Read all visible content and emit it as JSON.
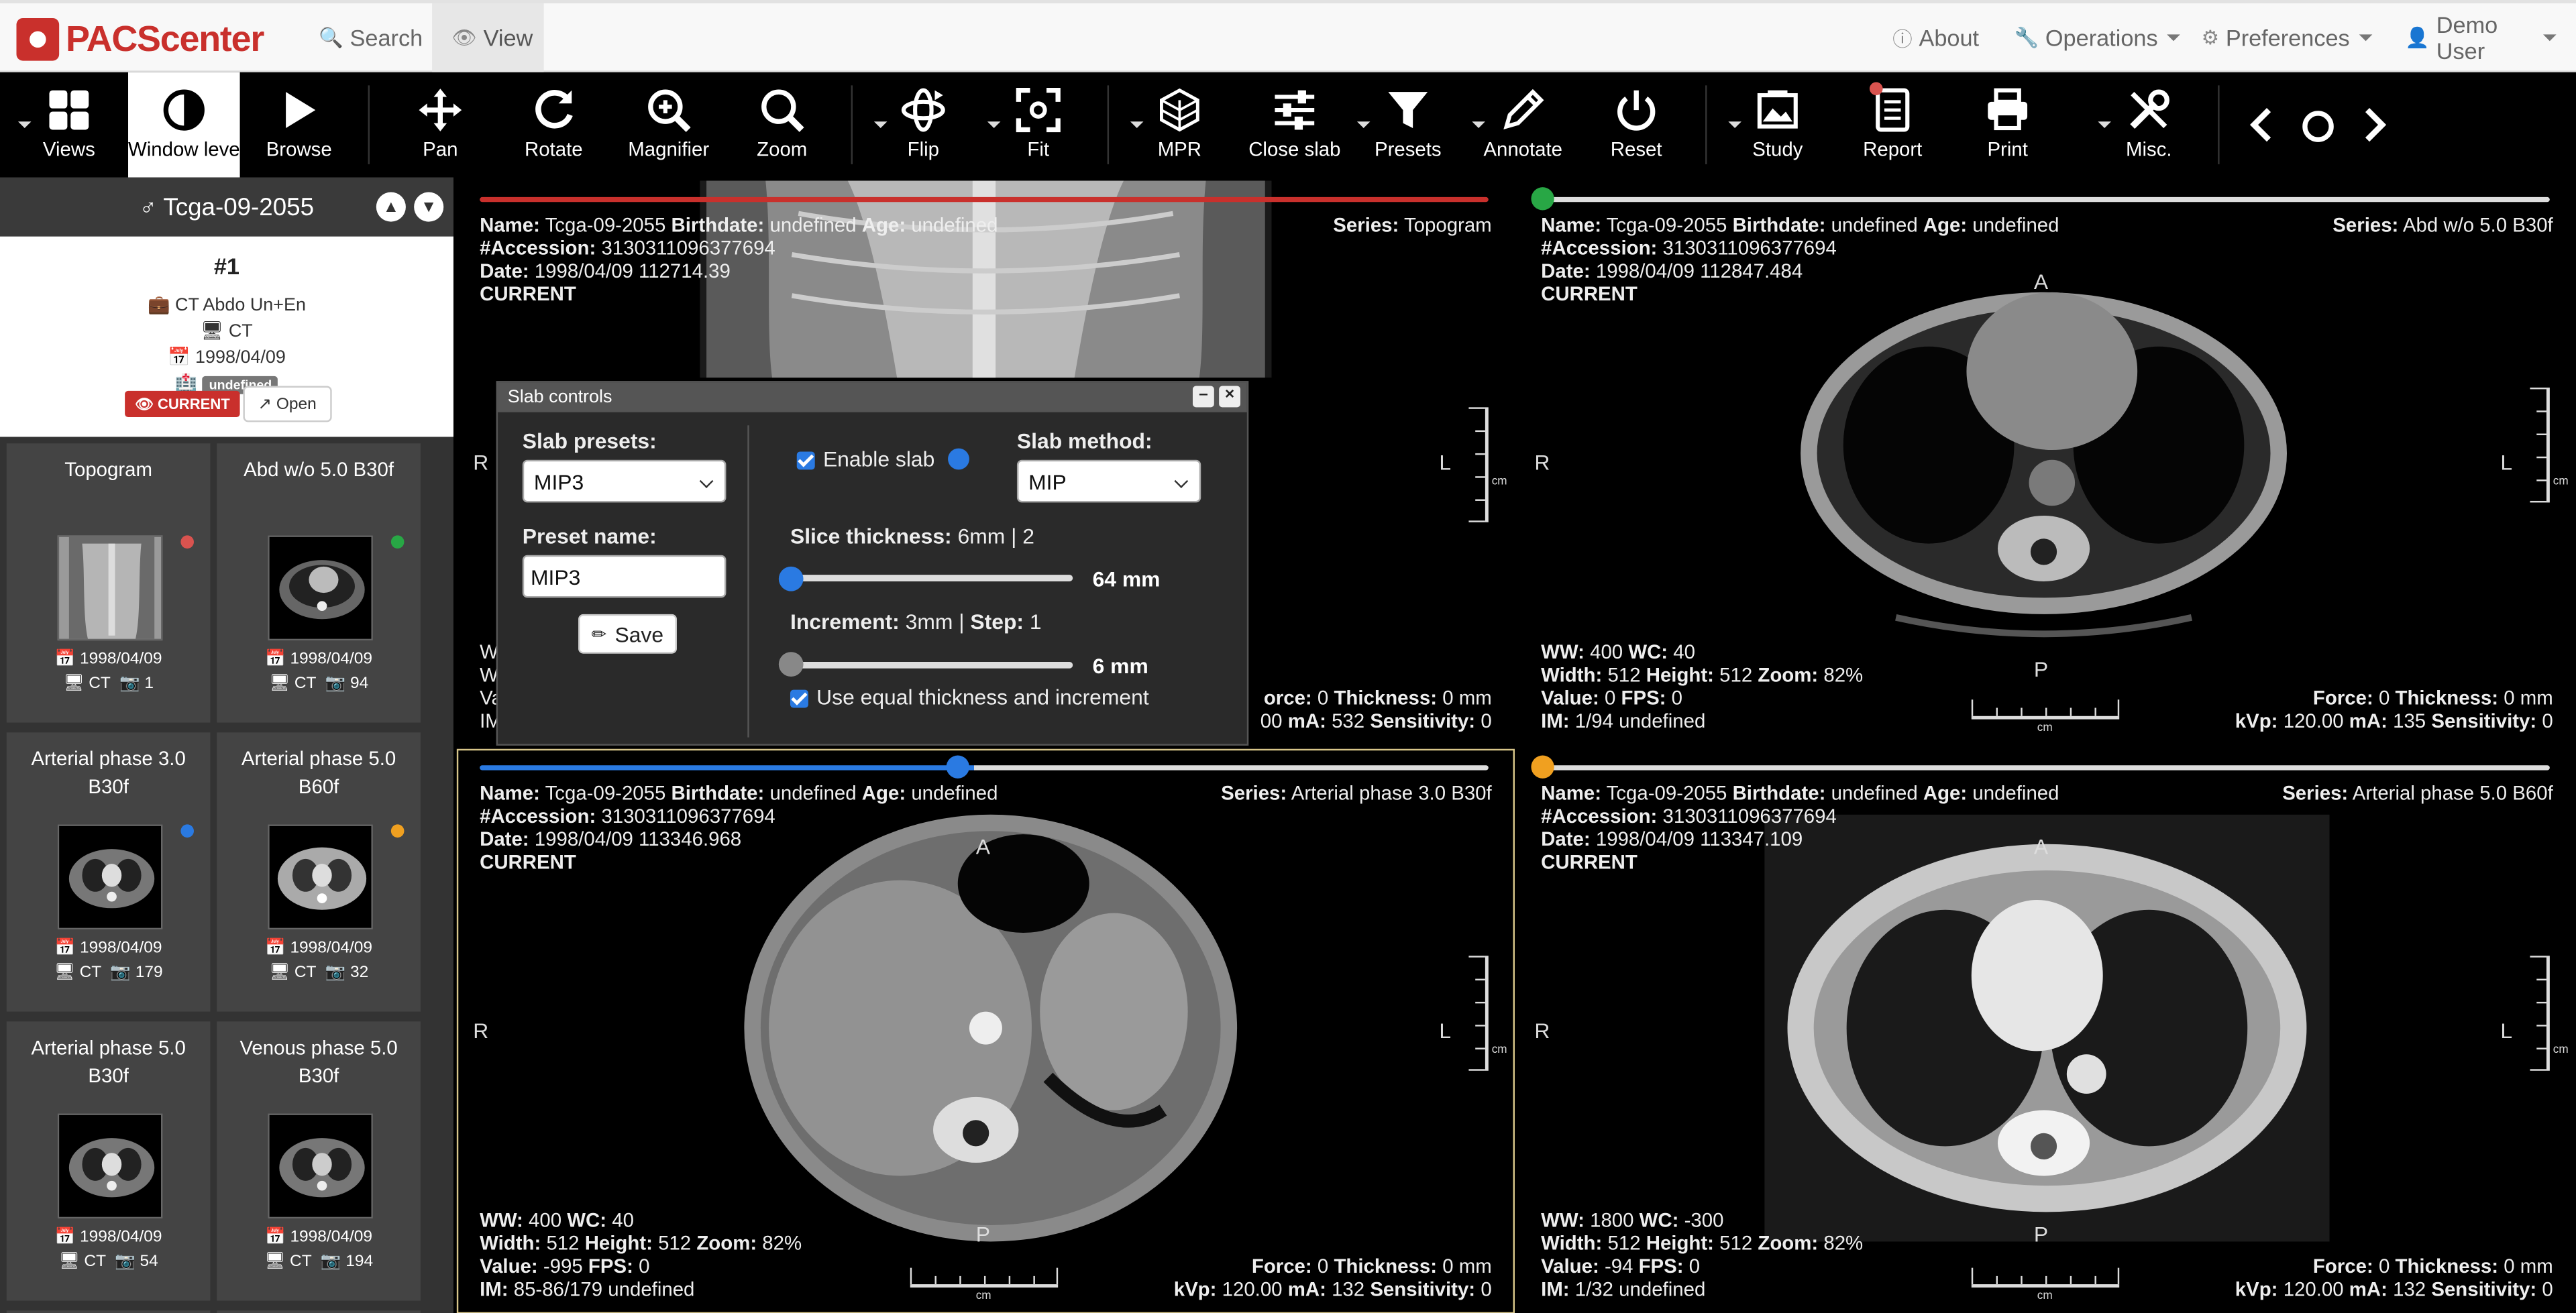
{
  "brand": {
    "name": "PACScenter"
  },
  "nav": {
    "search": "Search",
    "view": "View",
    "about": "About",
    "operations": "Operations",
    "preferences": "Preferences",
    "user": "Demo User"
  },
  "toolbar": {
    "views": "Views",
    "window_level": "Window level",
    "browse": "Browse",
    "pan": "Pan",
    "rotate": "Rotate",
    "magnifier": "Magnifier",
    "zoom": "Zoom",
    "flip": "Flip",
    "fit": "Fit",
    "mpr": "MPR",
    "close_slab": "Close slab",
    "presets": "Presets",
    "annotate": "Annotate",
    "reset": "Reset",
    "study": "Study",
    "report": "Report",
    "print": "Print",
    "misc": "Misc."
  },
  "patient": {
    "id": "Tcga-09-2055"
  },
  "study": {
    "number": "#1",
    "description": "CT Abdo Un+En",
    "modality": "CT",
    "date": "1998/04/09",
    "institution_label": "undefined",
    "current_label": "CURRENT",
    "open_label": "Open"
  },
  "series": [
    {
      "title": "Topogram",
      "date": "1998/04/09",
      "modality": "CT",
      "count": "1",
      "dot_color": "#d9534f"
    },
    {
      "title": "Abd w/o 5.0 B30f",
      "date": "1998/04/09",
      "modality": "CT",
      "count": "94",
      "dot_color": "#28a745"
    },
    {
      "title": "Arterial phase 3.0 B30f",
      "date": "1998/04/09",
      "modality": "CT",
      "count": "179",
      "dot_color": "#2a7ae2"
    },
    {
      "title": "Arterial phase 5.0 B60f",
      "date": "1998/04/09",
      "modality": "CT",
      "count": "32",
      "dot_color": "#f0a020"
    },
    {
      "title": "Arterial phase 5.0 B30f",
      "date": "1998/04/09",
      "modality": "CT",
      "count": "54"
    },
    {
      "title": "Venous phase 5.0 B30f",
      "date": "1998/04/09",
      "modality": "CT",
      "count": "194"
    }
  ],
  "viewports": [
    {
      "name_label": "Name:",
      "name": "Tcga-09-2055",
      "birth_label": "Birthdate:",
      "birth": "undefined",
      "age_label": "Age:",
      "age": "undefined",
      "acc_label": "#Accession:",
      "accession": "3130311096377694",
      "date_label": "Date:",
      "date": "1998/04/09 112714.39",
      "current": "CURRENT",
      "series_label": "Series:",
      "series": "Topogram",
      "ww_line": "W",
      "width_line": "W",
      "value_line": "Va",
      "im_line": "IM",
      "force_label": "orce:",
      "force": "0",
      "thick_label": "Thickness:",
      "thickness": "0 mm",
      "kvp_part": "00",
      "ma_label": "mA:",
      "ma": "532",
      "sens_label": "Sensitivity:",
      "sens": "0",
      "left_orient": "R",
      "right_orient": "L",
      "cm": "cm",
      "slider_color": "#c9302c"
    },
    {
      "name_label": "Name:",
      "name": "Tcga-09-2055",
      "birth_label": "Birthdate:",
      "birth": "undefined",
      "age_label": "Age:",
      "age": "undefined",
      "acc_label": "#Accession:",
      "accession": "3130311096377694",
      "date_label": "Date:",
      "date": "1998/04/09 112847.484",
      "current": "CURRENT",
      "series_label": "Series:",
      "series": "Abd w/o 5.0 B30f",
      "ww_label": "WW:",
      "ww": "400",
      "wc_label": "WC:",
      "wc": "40",
      "width_label": "Width:",
      "width": "512",
      "height_label": "Height:",
      "height": "512",
      "zoom_label": "Zoom:",
      "zoom": "82%",
      "value_label": "Value:",
      "value": "0",
      "fps_label": "FPS:",
      "fps": "0",
      "im_label": "IM:",
      "im": "1/94",
      "im_extra": "undefined",
      "force_label": "Force:",
      "force": "0",
      "thick_label": "Thickness:",
      "thickness": "0 mm",
      "kvp_label": "kVp:",
      "kvp": "120.00",
      "ma_label": "mA:",
      "ma": "135",
      "sens_label": "Sensitivity:",
      "sens": "0",
      "top_orient": "A",
      "bottom_orient": "P",
      "left_orient": "R",
      "right_orient": "L",
      "cm": "cm",
      "slider_color": "#28a745"
    },
    {
      "name_label": "Name:",
      "name": "Tcga-09-2055",
      "birth_label": "Birthdate:",
      "birth": "undefined",
      "age_label": "Age:",
      "age": "undefined",
      "acc_label": "#Accession:",
      "accession": "3130311096377694",
      "date_label": "Date:",
      "date": "1998/04/09 113346.968",
      "current": "CURRENT",
      "series_label": "Series:",
      "series": "Arterial phase 3.0 B30f",
      "ww_label": "WW:",
      "ww": "400",
      "wc_label": "WC:",
      "wc": "40",
      "width_label": "Width:",
      "width": "512",
      "height_label": "Height:",
      "height": "512",
      "zoom_label": "Zoom:",
      "zoom": "82%",
      "value_label": "Value:",
      "value": "-995",
      "fps_label": "FPS:",
      "fps": "0",
      "im_label": "IM:",
      "im": "85-86/179",
      "im_extra": "undefined",
      "force_label": "Force:",
      "force": "0",
      "thick_label": "Thickness:",
      "thickness": "0 mm",
      "kvp_label": "kVp:",
      "kvp": "120.00",
      "ma_label": "mA:",
      "ma": "132",
      "sens_label": "Sensitivity:",
      "sens": "0",
      "top_orient": "A",
      "bottom_orient": "P",
      "left_orient": "R",
      "right_orient": "L",
      "cm": "cm",
      "slider_color": "#2a7ae2"
    },
    {
      "name_label": "Name:",
      "name": "Tcga-09-2055",
      "birth_label": "Birthdate:",
      "birth": "undefined",
      "age_label": "Age:",
      "age": "undefined",
      "acc_label": "#Accession:",
      "accession": "3130311096377694",
      "date_label": "Date:",
      "date": "1998/04/09 113347.109",
      "current": "CURRENT",
      "series_label": "Series:",
      "series": "Arterial phase 5.0 B60f",
      "ww_label": "WW:",
      "ww": "1800",
      "wc_label": "WC:",
      "wc": "-300",
      "width_label": "Width:",
      "width": "512",
      "height_label": "Height:",
      "height": "512",
      "zoom_label": "Zoom:",
      "zoom": "82%",
      "value_label": "Value:",
      "value": "-94",
      "fps_label": "FPS:",
      "fps": "0",
      "im_label": "IM:",
      "im": "1/32",
      "im_extra": "undefined",
      "force_label": "Force:",
      "force": "0",
      "thick_label": "Thickness:",
      "thickness": "0 mm",
      "kvp_label": "kVp:",
      "kvp": "120.00",
      "ma_label": "mA:",
      "ma": "132",
      "sens_label": "Sensitivity:",
      "sens": "0",
      "top_orient": "A",
      "bottom_orient": "P",
      "left_orient": "R",
      "right_orient": "L",
      "cm": "cm",
      "slider_color": "#f0a020"
    }
  ],
  "slab_dialog": {
    "title": "Slab controls",
    "presets_label": "Slab presets:",
    "preset_value": "MIP3",
    "preset_name_label": "Preset name:",
    "preset_name_value": "MIP3",
    "save_label": "Save",
    "enable_label": "Enable slab",
    "method_label": "Slab method:",
    "method_value": "MIP",
    "thickness_label": "Slice thickness:",
    "thickness_info": "6mm | 2",
    "thickness_value": "64 mm",
    "increment_label": "Increment:",
    "increment_info": "3mm |",
    "step_label": "Step:",
    "step_value": "1",
    "increment_value": "6 mm",
    "equal_label": "Use equal thickness and increment",
    "accent": "#2a7ae2"
  }
}
